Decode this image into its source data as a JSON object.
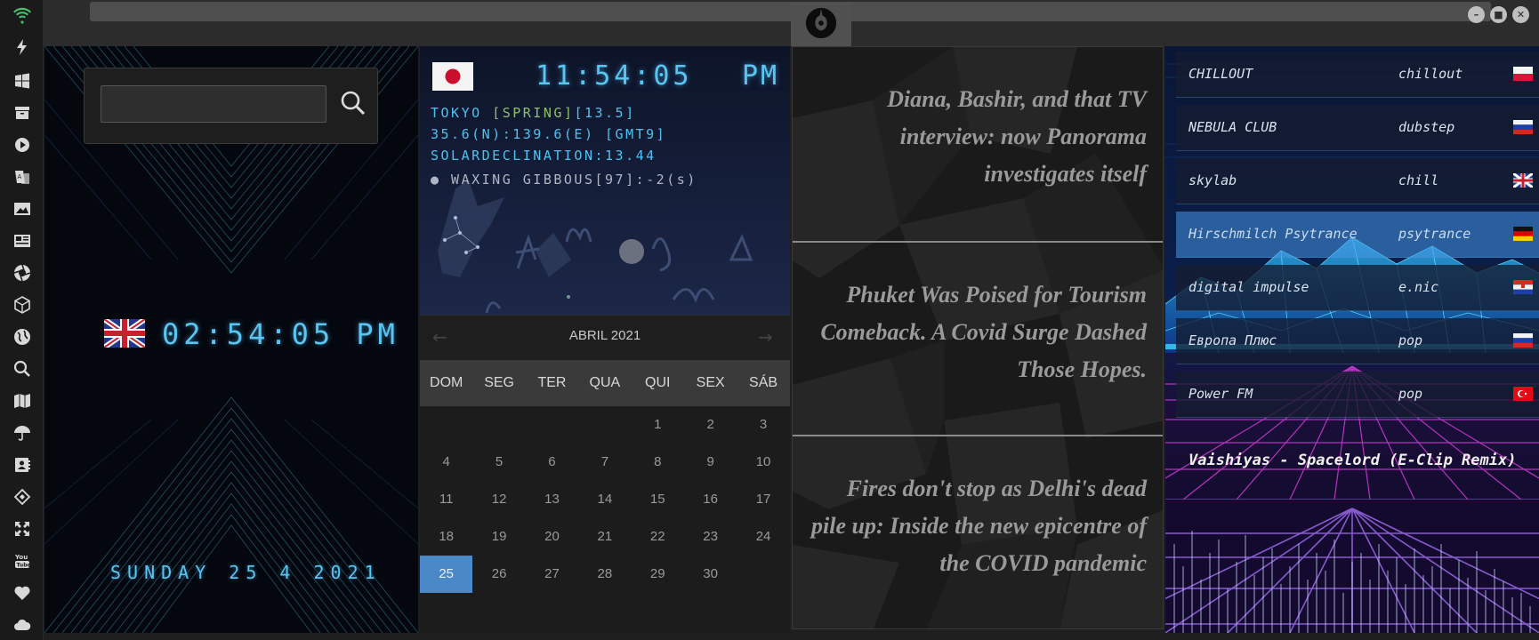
{
  "window": {
    "controls": {
      "minimize": "–",
      "maximize": "■",
      "close": "✕"
    }
  },
  "rail": {
    "icons": [
      "wifi-icon",
      "bolt-icon",
      "windows-icon",
      "archive-icon",
      "play-icon",
      "translate-icon",
      "image-icon",
      "news-icon",
      "aperture-icon",
      "cube-icon",
      "globe-icon",
      "search-icon",
      "map-icon",
      "umbrella-icon",
      "contacts-icon",
      "code-icon",
      "fullscreen-icon",
      "youtube-icon",
      "heart-icon",
      "cloud-icon"
    ]
  },
  "world_clock": {
    "search": {
      "value": "",
      "placeholder": ""
    },
    "time": "02:54:05 PM",
    "date": "SUNDAY 25 4 2021",
    "flag": "uk-flag"
  },
  "tokyo": {
    "time": "11:54:05",
    "ampm": "PM",
    "line1_city": "TOKYO ",
    "line1_season": "[SPRING]",
    "line1_temp": "[13.5]",
    "line2": "35.6(N):139.6(E) [GMT9]",
    "line3": "SOLARDECLINATION:13.44",
    "moon": "● WAXING GIBBOUS[97]:-2(s)",
    "flag": "japan-flag"
  },
  "calendar": {
    "title": "ABRIL 2021",
    "prev": "←",
    "next": "→",
    "weekdays": [
      "DOM",
      "SEG",
      "TER",
      "QUA",
      "QUI",
      "SEX",
      "SÁB"
    ],
    "weeks": [
      [
        "",
        "",
        "",
        "",
        "1",
        "2",
        "3"
      ],
      [
        "4",
        "5",
        "6",
        "7",
        "8",
        "9",
        "10"
      ],
      [
        "11",
        "12",
        "13",
        "14",
        "15",
        "16",
        "17"
      ],
      [
        "18",
        "19",
        "20",
        "21",
        "22",
        "23",
        "24"
      ],
      [
        "25",
        "26",
        "27",
        "28",
        "29",
        "30",
        ""
      ]
    ],
    "today": "25"
  },
  "news": {
    "items": [
      "Diana, Bashir, and that TV interview: now Panorama investigates itself",
      "Phuket Was Poised for Tourism Comeback. A Covid Surge Dashed Those Hopes.",
      "Fires don't stop as Delhi's dead pile up: Inside the new epicentre of the COVID pandemic"
    ]
  },
  "radio": {
    "stations": [
      {
        "name": "CHILLOUT",
        "genre": "chillout",
        "flag": "poland"
      },
      {
        "name": "NEBULA CLUB",
        "genre": "dubstep",
        "flag": "russia"
      },
      {
        "name": "skylab",
        "genre": "chill",
        "flag": "uk"
      },
      {
        "name": "Hirschmilch Psytrance",
        "genre": "psytrance",
        "flag": "germany"
      },
      {
        "name": "digital impulse",
        "genre": "e.nic",
        "flag": "croatia"
      },
      {
        "name": "Европа Плюс",
        "genre": "pop",
        "flag": "russia"
      },
      {
        "name": "Power FM",
        "genre": "pop",
        "flag": "turkey"
      }
    ],
    "active_station": "Hirschmilch Psytrance",
    "now_playing": "Vaishiyas - Spacelord (E-Clip Remix)"
  },
  "colors": {
    "clock_cyan": "#59c6f2",
    "calendar_today": "#4b88c8",
    "rail_icon": "#d8d8d8",
    "wifi_green": "#47c26a"
  }
}
